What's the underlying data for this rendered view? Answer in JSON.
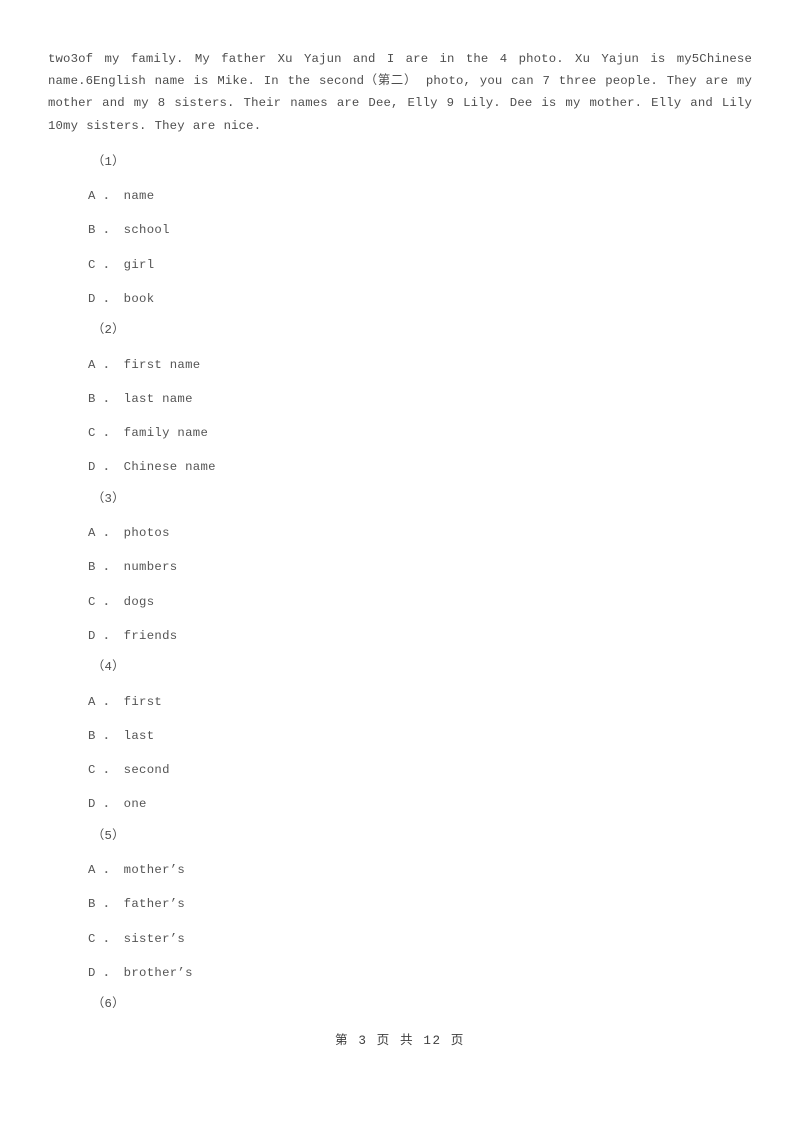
{
  "document": {
    "page_footer": "第 3 页 共 12 页",
    "page_number": "3",
    "total_pages": "12"
  },
  "passage": {
    "text": "two3of my family. My father Xu Yajun and I are in the 4 photo. Xu Yajun is my5Chinese name.6English name is Mike. In the second（第二） photo, you can 7 three people. They are my mother and my 8 sisters. Their names are Dee, Elly 9 Lily. Dee is my mother. Elly and Lily 10my sisters. They are nice."
  },
  "questions": [
    {
      "number": "（1）",
      "options": [
        {
          "letter": "A",
          "sep": "．",
          "text": "name"
        },
        {
          "letter": "B",
          "sep": "．",
          "text": "school"
        },
        {
          "letter": "C",
          "sep": "．",
          "text": "girl"
        },
        {
          "letter": "D",
          "sep": "．",
          "text": "book"
        }
      ]
    },
    {
      "number": "（2）",
      "options": [
        {
          "letter": "A",
          "sep": "．",
          "text": "first name"
        },
        {
          "letter": "B",
          "sep": "．",
          "text": "last name"
        },
        {
          "letter": "C",
          "sep": "．",
          "text": "family name"
        },
        {
          "letter": "D",
          "sep": "．",
          "text": "Chinese name"
        }
      ]
    },
    {
      "number": "（3）",
      "options": [
        {
          "letter": "A",
          "sep": "．",
          "text": "photos"
        },
        {
          "letter": "B",
          "sep": "．",
          "text": "numbers"
        },
        {
          "letter": "C",
          "sep": "．",
          "text": "dogs"
        },
        {
          "letter": "D",
          "sep": "．",
          "text": "friends"
        }
      ]
    },
    {
      "number": "（4）",
      "options": [
        {
          "letter": "A",
          "sep": "．",
          "text": "first"
        },
        {
          "letter": "B",
          "sep": "．",
          "text": "last"
        },
        {
          "letter": "C",
          "sep": "．",
          "text": "second"
        },
        {
          "letter": "D",
          "sep": "．",
          "text": "one"
        }
      ]
    },
    {
      "number": "（5）",
      "options": [
        {
          "letter": "A",
          "sep": "．",
          "text": "mother’s"
        },
        {
          "letter": "B",
          "sep": "．",
          "text": "father’s"
        },
        {
          "letter": "C",
          "sep": "．",
          "text": "sister’s"
        },
        {
          "letter": "D",
          "sep": "．",
          "text": "brother’s"
        }
      ]
    },
    {
      "number": "（6）",
      "options": []
    }
  ]
}
